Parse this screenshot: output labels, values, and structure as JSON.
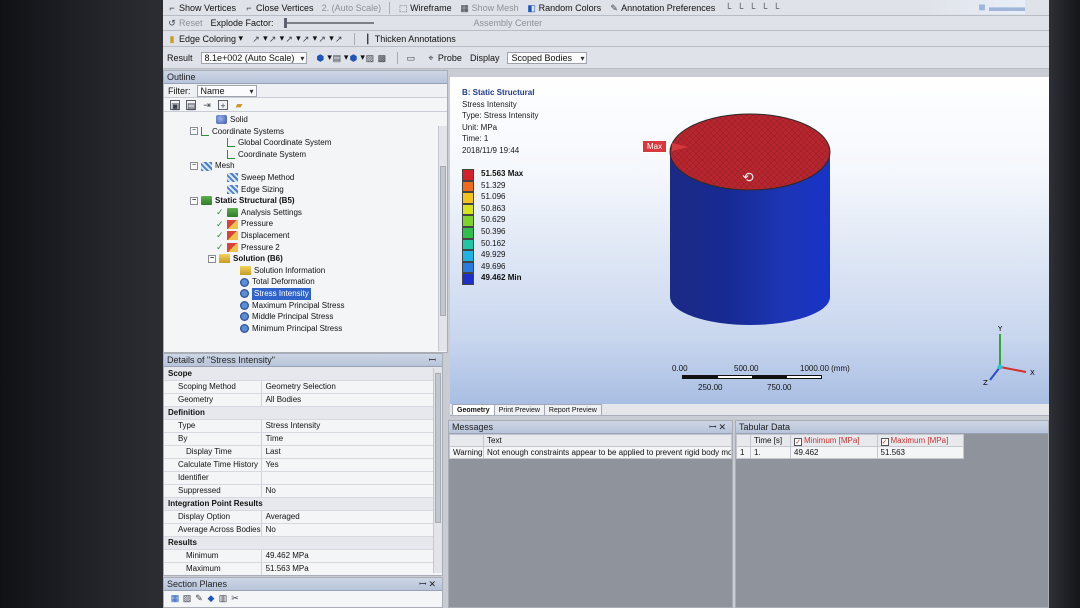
{
  "toolbar1": {
    "show_vertices": "Show Vertices",
    "close_vertices": "Close Vertices",
    "scale_value": "2. (Auto Scale)",
    "wireframe": "Wireframe",
    "show_mesh": "Show Mesh",
    "random_colors": "Random Colors",
    "annotation_prefs": "Annotation Preferences"
  },
  "toolbar2": {
    "reset": "Reset",
    "explode_factor": "Explode Factor:",
    "assembly_center": "Assembly Center"
  },
  "toolbar3": {
    "edge_coloring": "Edge Coloring",
    "thicken_annotations": "Thicken Annotations"
  },
  "toolbar4": {
    "result_label": "Result",
    "result_scale": "8.1e+002 (Auto Scale)",
    "probe": "Probe",
    "display_label": "Display",
    "display_value": "Scoped Bodies"
  },
  "outline": {
    "title": "Outline",
    "filter_label": "Filter:",
    "filter_value": "Name",
    "nodes": [
      "Solid",
      "Coordinate Systems",
      "Global Coordinate System",
      "Coordinate System",
      "Mesh",
      "Sweep Method",
      "Edge Sizing",
      "Static Structural (B5)",
      "Analysis Settings",
      "Pressure",
      "Displacement",
      "Pressure 2",
      "Solution (B6)",
      "Solution Information",
      "Total Deformation",
      "Stress Intensity",
      "Maximum Principal Stress",
      "Middle Principal Stress",
      "Minimum Principal Stress"
    ]
  },
  "details": {
    "title": "Details of \"Stress Intensity\"",
    "rows": [
      [
        "Scope",
        ""
      ],
      [
        "Scoping Method",
        "Geometry Selection"
      ],
      [
        "Geometry",
        "All Bodies"
      ],
      [
        "Definition",
        ""
      ],
      [
        "Type",
        "Stress Intensity"
      ],
      [
        "By",
        "Time"
      ],
      [
        "Display Time",
        "Last"
      ],
      [
        "Calculate Time History",
        "Yes"
      ],
      [
        "Identifier",
        ""
      ],
      [
        "Suppressed",
        "No"
      ],
      [
        "Integration Point Results",
        ""
      ],
      [
        "Display Option",
        "Averaged"
      ],
      [
        "Average Across Bodies",
        "No"
      ],
      [
        "Results",
        ""
      ],
      [
        "Minimum",
        "49.462 MPa"
      ],
      [
        "Maximum",
        "51.563 MPa"
      ]
    ]
  },
  "section_planes": {
    "title": "Section Planes"
  },
  "viewport": {
    "header": {
      "title": "B: Static Structural",
      "result": "Stress Intensity",
      "type": "Type: Stress Intensity",
      "unit": "Unit: MPa",
      "time": "Time: 1",
      "date": "2018/11/9 19:44"
    },
    "legend": [
      "51.563 Max",
      "51.329",
      "51.096",
      "50.863",
      "50.629",
      "50.396",
      "50.162",
      "49.929",
      "49.696",
      "49.462 Min"
    ],
    "legend_colors": [
      "#d3212a",
      "#ee6a1c",
      "#f2c21d",
      "#d6e31d",
      "#7fd12b",
      "#2fbf4a",
      "#1fc7a4",
      "#1fb3e3",
      "#2a7be0",
      "#1d2fc8"
    ],
    "max_tag": "Max",
    "scale": {
      "t0": "0.00",
      "t1": "250.00",
      "t2": "500.00",
      "t3": "750.00",
      "t4": "1000.00 (mm)"
    },
    "axes": {
      "x": "X",
      "y": "Y",
      "z": "Z"
    }
  },
  "tabs": [
    "Geometry",
    "Print Preview",
    "Report Preview"
  ],
  "messages": {
    "title": "Messages",
    "col_text": "Text",
    "row_type": "Warning",
    "row_text": "Not enough constraints appear to be applied to prevent rigid body motion."
  },
  "tabular": {
    "title": "Tabular Data",
    "col_time": "Time [s]",
    "col_min": "Minimum [MPa]",
    "col_max": "Maximum [MPa]",
    "row_idx": "1",
    "row_time": "1.",
    "row_min": "49.462",
    "row_max": "51.563"
  }
}
